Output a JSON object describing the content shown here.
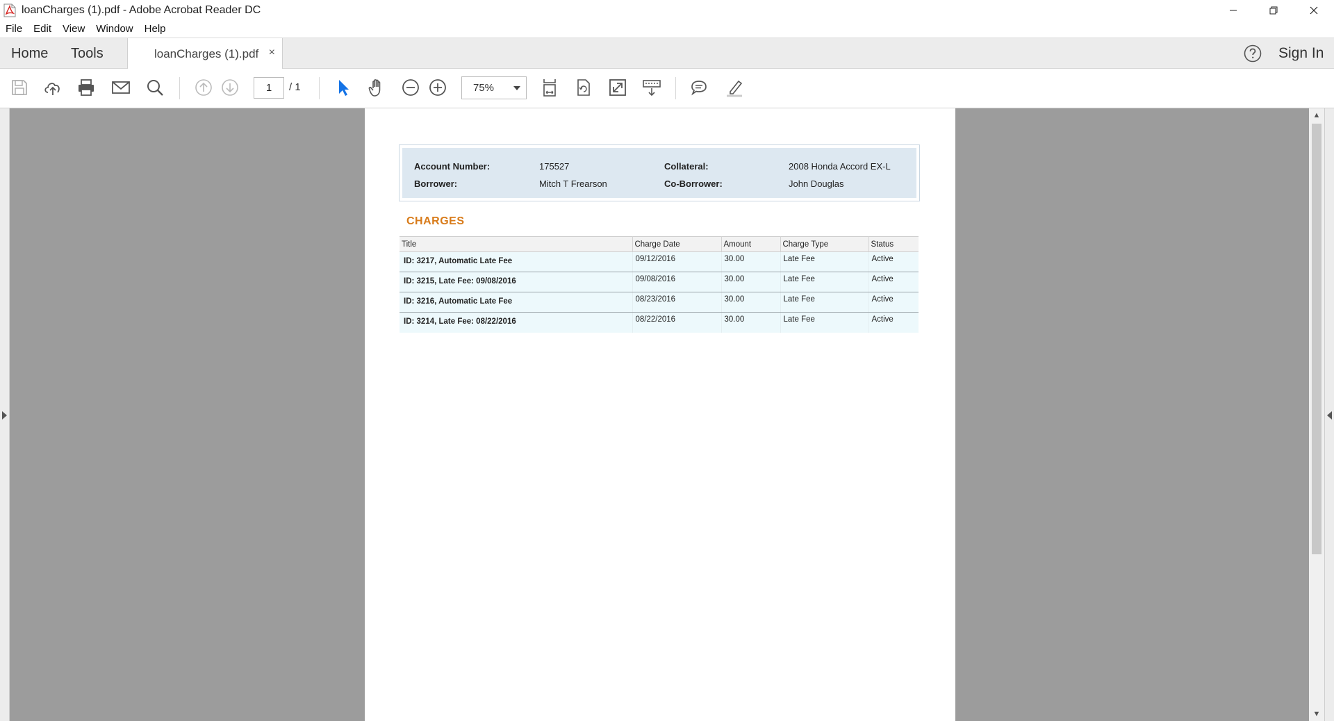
{
  "window": {
    "title": "loanCharges (1).pdf - Adobe Acrobat Reader DC"
  },
  "menu": [
    "File",
    "Edit",
    "View",
    "Window",
    "Help"
  ],
  "tabs": {
    "home": "Home",
    "tools": "Tools",
    "document": "loanCharges (1).pdf",
    "close_symbol": "×",
    "sign_in": "Sign In"
  },
  "toolbar": {
    "page_current": "1",
    "page_total": "/ 1",
    "zoom": "75%",
    "icons": [
      "save-icon",
      "upload-icon",
      "print-icon",
      "email-icon",
      "search-icon",
      "page-up-icon",
      "page-down-icon",
      "select-cursor-icon",
      "hand-icon",
      "zoom-out-icon",
      "zoom-in-icon",
      "fit-page-icon",
      "rotate-icon",
      "fullscreen-icon",
      "scroll-mode-icon",
      "comment-icon",
      "highlight-icon"
    ]
  },
  "document": {
    "info": {
      "account_label": "Account Number:",
      "account_value": "175527",
      "collateral_label": "Collateral:",
      "collateral_value": "2008 Honda Accord EX-L",
      "borrower_label": "Borrower:",
      "borrower_value": "Mitch T Frearson",
      "coborrower_label": "Co-Borrower:",
      "coborrower_value": "John Douglas"
    },
    "section_title": "CHARGES",
    "columns": [
      "Title",
      "Charge Date",
      "Amount",
      "Charge Type",
      "Status"
    ],
    "rows": [
      [
        "ID: 3217, Automatic Late Fee",
        "09/12/2016",
        "30.00",
        "Late Fee",
        "Active"
      ],
      [
        "ID: 3215, Late Fee: 09/08/2016",
        "09/08/2016",
        "30.00",
        "Late Fee",
        "Active"
      ],
      [
        "ID: 3216, Automatic Late Fee",
        "08/23/2016",
        "30.00",
        "Late Fee",
        "Active"
      ],
      [
        "ID: 3214, Late Fee: 08/22/2016",
        "08/22/2016",
        "30.00",
        "Late Fee",
        "Active"
      ]
    ]
  },
  "colors": {
    "accent_orange": "#d87b1a",
    "acrobat_blue": "#1473e6",
    "info_bg": "#dde8f1",
    "row_bg": "#edf9fc"
  }
}
